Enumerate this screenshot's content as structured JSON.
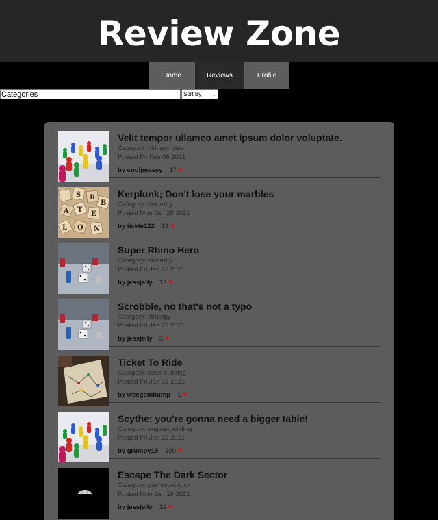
{
  "site": {
    "title": "Review Zone"
  },
  "nav": [
    {
      "label": "Home"
    },
    {
      "label": "Reviews"
    },
    {
      "label": "Profile"
    }
  ],
  "filters": {
    "category_placeholder": "Categories",
    "sort_label": "Sort By"
  },
  "colors": {
    "heart": "#e01010",
    "panel": "#5c5c5c",
    "header": "#262626"
  },
  "reviews": [
    {
      "title": "Velit tempor ullamco amet ipsum dolor voluptate.",
      "category": "Category: hidden-roles",
      "date": "Posted Fri Feb 05 2021",
      "author": "by cooljmessy",
      "likes": "17",
      "image": "pawns-icon"
    },
    {
      "title": "Kerplunk; Don't lose your marbles",
      "category": "Category: dexterity",
      "date": "Posted Mon Jan 25 2021",
      "author": "by tickle122",
      "likes": "13",
      "image": "letter-tiles-icon"
    },
    {
      "title": "Super Rhino Hero",
      "category": "Category: dexterity",
      "date": "Posted Fri Jan 22 2021",
      "author": "by jessjelly",
      "likes": "12",
      "image": "dice-board-icon"
    },
    {
      "title": "Scrobble, no that's not a typo",
      "category": "Category: strategy",
      "date": "Posted Fri Jan 22 2021",
      "author": "by jessjelly",
      "likes": "3",
      "image": "dice-board-icon"
    },
    {
      "title": "Ticket To Ride",
      "category": "Category: deck-building",
      "date": "Posted Fri Jan 22 2021",
      "author": "by weegembump",
      "likes": "1",
      "image": "map-board-icon"
    },
    {
      "title": "Scythe; you're gonna need a bigger table!",
      "category": "Category: engine-building",
      "date": "Posted Fri Jan 22 2021",
      "author": "by grumpy19",
      "likes": "100",
      "image": "pawns-icon"
    },
    {
      "title": "Escape The Dark Sector",
      "category": "Category: push-your-luck",
      "date": "Posted Mon Jan 18 2021",
      "author": "by jessjelly",
      "likes": "12",
      "image": "moon-icon"
    }
  ]
}
